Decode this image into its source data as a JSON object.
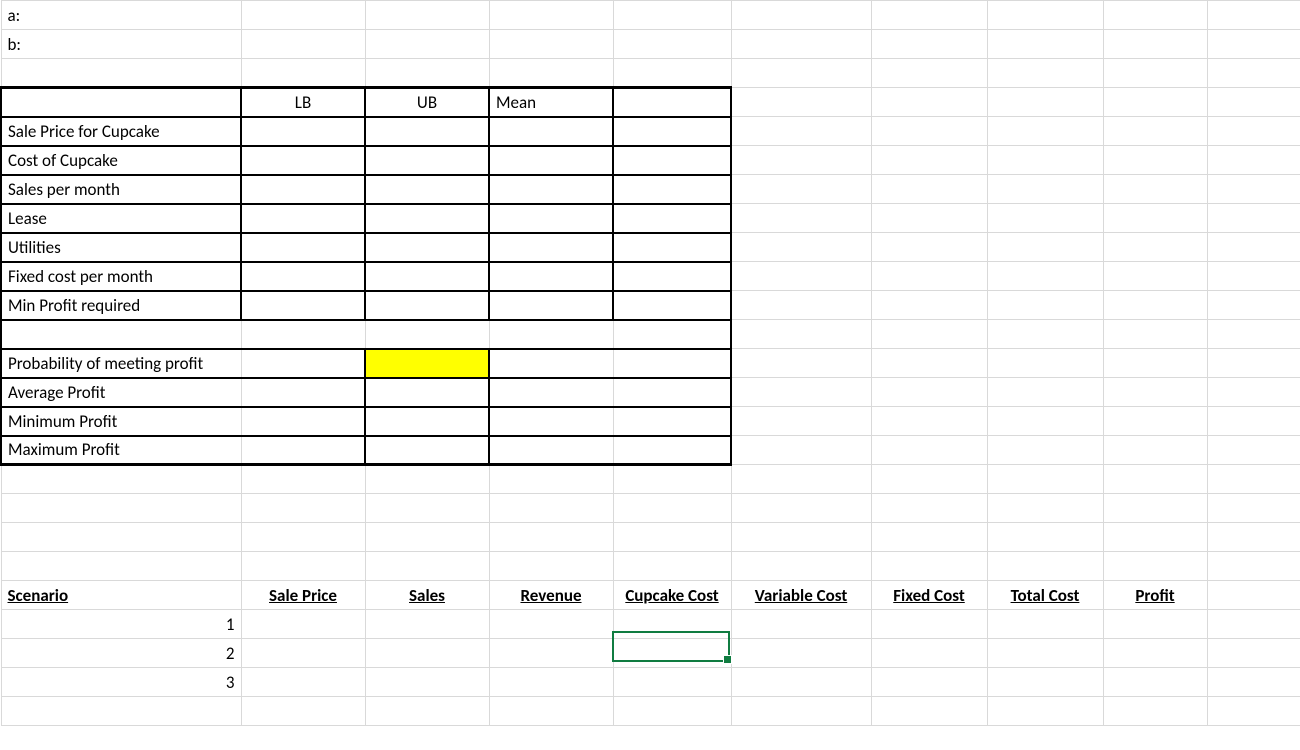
{
  "labels": {
    "a": "a:",
    "b": "b:",
    "LB": "LB",
    "UB": "UB",
    "Mean": "Mean",
    "sale_price_cupcake": "Sale Price for Cupcake",
    "cost_cupcake": "Cost of Cupcake",
    "sales_month": "Sales per month",
    "lease": "Lease",
    "utilities": "Utilities",
    "fixed_cost_month": "Fixed cost per month",
    "min_profit_req": "Min Profit required",
    "prob_meeting_profit": "Probability of meeting profit",
    "avg_profit": "Average Profit",
    "min_profit": "Minimum Profit",
    "max_profit": "Maximum Profit"
  },
  "scenario_headers": {
    "scenario": "Scenario",
    "sale_price": "Sale Price",
    "sales": "Sales",
    "revenue": "Revenue",
    "cupcake_cost": "Cupcake Cost",
    "variable_cost": "Variable Cost",
    "fixed_cost": "Fixed Cost",
    "total_cost": "Total Cost",
    "profit": "Profit"
  },
  "scenario_rows": [
    "1",
    "2",
    "3"
  ],
  "colors": {
    "highlight": "#ffff00",
    "selection": "#107c41",
    "gridline": "#d9d9d9"
  }
}
